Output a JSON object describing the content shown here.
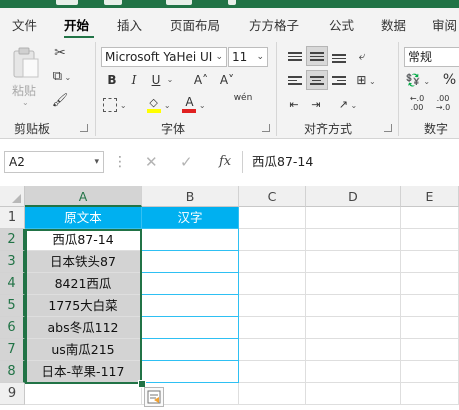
{
  "menu": {
    "items": [
      "文件",
      "开始",
      "插入",
      "页面布局",
      "方方格子",
      "公式",
      "数据",
      "审阅"
    ],
    "active": "开始"
  },
  "ribbon": {
    "clipboard": {
      "label": "剪贴板",
      "paste_label": "粘贴"
    },
    "font": {
      "label": "字体",
      "font_name": "Microsoft YaHei UI",
      "font_size": "11",
      "bold": "B",
      "italic": "I",
      "underline": "U",
      "grow": "A˄",
      "shrink": "A˅",
      "pinyin": "wén",
      "font_color": "#e02020",
      "fill_color": "#ffff00"
    },
    "alignment": {
      "label": "对齐方式"
    },
    "number": {
      "label": "数字",
      "format": "常规",
      "percent": "%"
    }
  },
  "formula_bar": {
    "cell_ref": "A2",
    "fx": "fx",
    "content": "西瓜87-14"
  },
  "sheet": {
    "columns": [
      "A",
      "B",
      "C",
      "D",
      "E"
    ],
    "rows": [
      "1",
      "2",
      "3",
      "4",
      "5",
      "6",
      "7",
      "8",
      "9"
    ],
    "header_a": "原文本",
    "header_b": "汉字",
    "values": [
      "西瓜87-14",
      "日本铁头87",
      "8421西瓜",
      "1775大白菜",
      "abs冬瓜112",
      "us南瓜215",
      "日本-苹果-117"
    ],
    "header_color": "#00b0f0",
    "selection_color": "#217346"
  }
}
